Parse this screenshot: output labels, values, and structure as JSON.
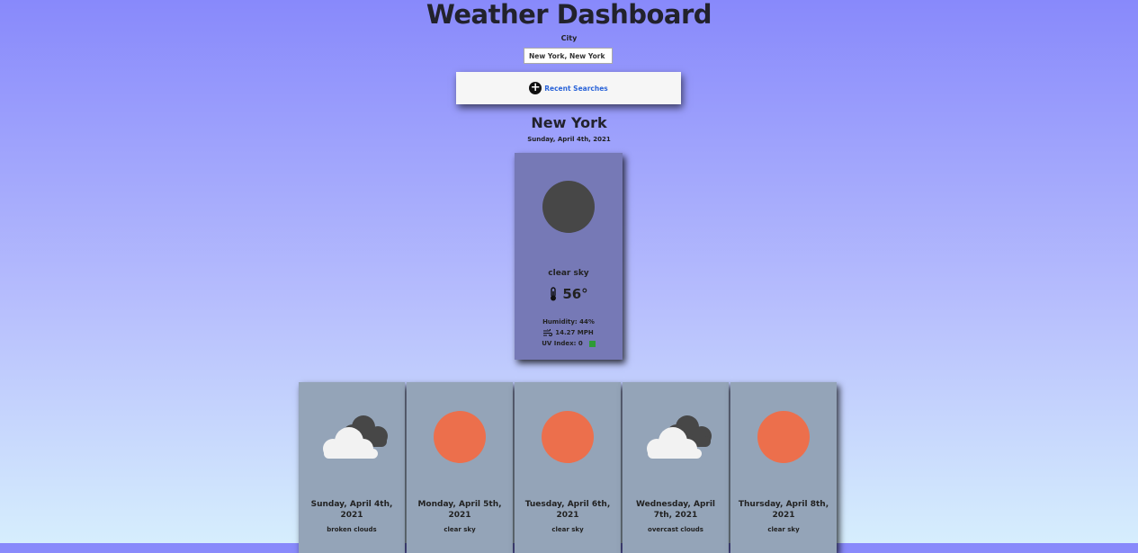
{
  "header": {
    "title": "Weather Dashboard"
  },
  "search": {
    "label": "City",
    "value": "New York, New York"
  },
  "recent": {
    "label": "Recent Searches",
    "icon": "plus-circle-icon"
  },
  "current": {
    "city": "New York",
    "date": "Sunday, April 4th, 2021",
    "icon": "moon-icon",
    "description": "clear sky",
    "temperature": "56°",
    "humidity": "Humidity: 44%",
    "wind": "14.27 MPH",
    "uv": "UV Index: 0",
    "uv_color": "#2e9b36"
  },
  "forecast": [
    {
      "date": "Sunday, April 4th, 2021",
      "description": "broken clouds",
      "icon": "cloud-icon"
    },
    {
      "date": "Monday, April 5th, 2021",
      "description": "clear sky",
      "icon": "sun-icon"
    },
    {
      "date": "Tuesday, April 6th, 2021",
      "description": "clear sky",
      "icon": "sun-icon"
    },
    {
      "date": "Wednesday, April 7th, 2021",
      "description": "overcast clouds",
      "icon": "cloud-icon"
    },
    {
      "date": "Thursday, April 8th, 2021",
      "description": "clear sky",
      "icon": "sun-icon"
    }
  ],
  "colors": {
    "sun": "#ec6f4c",
    "moon": "#474747",
    "card_current": "#7679b6",
    "card_forecast": "#94a4b8",
    "link": "#2b64d8"
  }
}
